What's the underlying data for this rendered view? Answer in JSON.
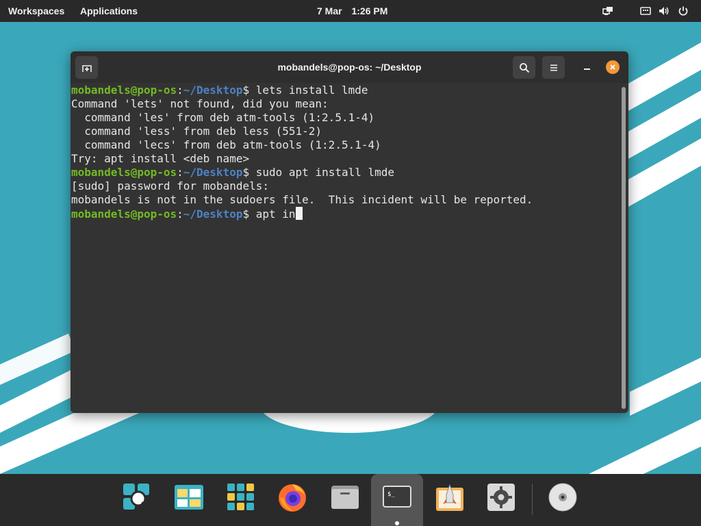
{
  "topbar": {
    "workspaces": "Workspaces",
    "applications": "Applications",
    "date": "7 Mar",
    "time": "1:26 PM",
    "status_icons": [
      "network-icon",
      "keyboard-icon",
      "volume-icon",
      "power-icon"
    ]
  },
  "window": {
    "title": "mobandels@pop-os: ~/Desktop",
    "buttons": [
      "new-tab-icon",
      "search-icon",
      "menu-icon",
      "minimize-icon",
      "close-icon"
    ]
  },
  "terminal": {
    "prompt_user": "mobandels@pop-os",
    "prompt_sep": ":",
    "prompt_path": "~/Desktop",
    "prompt_end": "$",
    "cmd1": " lets install lmde",
    "out1": "Command 'lets' not found, did you mean:",
    "out2": "  command 'les' from deb atm-tools (1:2.5.1-4)",
    "out3": "  command 'less' from deb less (551-2)",
    "out4": "  command 'lecs' from deb atm-tools (1:2.5.1-4)",
    "out5": "Try: apt install <deb name>",
    "cmd2": " sudo apt install lmde",
    "out6": "[sudo] password for mobandels:",
    "out7": "mobandels is not in the sudoers file.  This incident will be reported.",
    "cmd3": " apt in"
  },
  "dock": {
    "items": [
      "launcher-icon",
      "workspaces-icon",
      "app-grid-icon",
      "firefox-icon",
      "files-icon",
      "terminal-icon",
      "popshop-icon",
      "settings-icon",
      "disc-icon"
    ],
    "active": "terminal-icon"
  },
  "colors": {
    "wallpaper": "#3aa8ba",
    "topbar": "#292929",
    "terminal_bg": "#333333",
    "prompt_user": "#73ba25",
    "prompt_path": "#4c83c3",
    "close_button": "#f3973c"
  }
}
